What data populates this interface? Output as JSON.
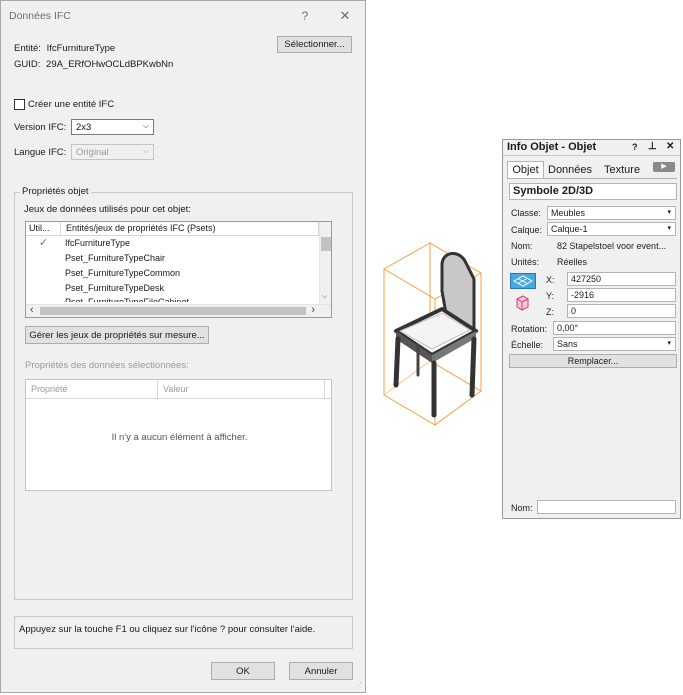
{
  "ifc_dialog": {
    "title": "Données IFC",
    "help_icon": "?",
    "close_icon": "✕",
    "entity_label": "Entité:",
    "entity_value": "IfcFurnitureType",
    "guid_label": "GUID:",
    "guid_value": "29A_ERfOHwOCLdBPKwbNn",
    "select_button": "Sélectionner...",
    "create_entity_label": "Créer une entité IFC",
    "ifc_version_label": "Version IFC:",
    "ifc_version_value": "2x3",
    "ifc_language_label": "Langue IFC:",
    "ifc_language_value": "Original",
    "object_properties_group": "Propriétés objet",
    "datasets_label": "Jeux de données utilisés pour cet objet:",
    "psets_table": {
      "columns": [
        "Util...",
        "Entités/jeux de propriétés IFC (Psets)"
      ],
      "rows": [
        {
          "used": "✓",
          "name": "IfcFurnitureType"
        },
        {
          "used": "",
          "name": "Pset_FurnitureTypeChair"
        },
        {
          "used": "",
          "name": "Pset_FurnitureTypeCommon"
        },
        {
          "used": "",
          "name": "Pset_FurnitureTypeDesk"
        },
        {
          "used": "",
          "name": "Pset_FurnitureTypeFileCabinet"
        }
      ]
    },
    "manage_psets_button": "Gérer les jeux de propriétés sur mesure...",
    "selected_data_props_label": "Propriétés des données sélectionnées:",
    "props_table": {
      "columns": [
        "Propriété",
        "Valeur"
      ],
      "empty_text": "Il n'y a aucun élément à afficher."
    },
    "help_text": "Appuyez sur la touche F1 ou cliquez sur l'icône ? pour consulter l'aide.",
    "ok_button": "OK",
    "cancel_button": "Annuler"
  },
  "info_panel": {
    "title": "Info Objet - Objet",
    "title_icons": [
      "?",
      "⊥",
      "✕"
    ],
    "tabs": [
      "Objet",
      "Données",
      "Texture"
    ],
    "active_tab": "Objet",
    "object_type": "Symbole 2D/3D",
    "class_label": "Classe:",
    "class_value": "Meubles",
    "layer_label": "Calque:",
    "layer_value": "Calque-1",
    "name_label": "Nom:",
    "name_value": "82 Stapelstoel voor event...",
    "units_label": "Unités:",
    "units_value": "Réelles",
    "x_label": "X:",
    "x_value": "427250",
    "y_label": "Y:",
    "y_value": "-2916",
    "z_label": "Z:",
    "z_value": "0",
    "rotation_label": "Rotation:",
    "rotation_value": "0,00°",
    "scale_label": "Échelle:",
    "scale_value": "Sans",
    "replace_button": "Remplacer...",
    "bottom_name_label": "Nom:",
    "bottom_name_value": ""
  },
  "colors": {
    "dialog_bg": "#f0f0f0",
    "bounding_box": "#f0a040",
    "chair_frame": "#333333"
  }
}
